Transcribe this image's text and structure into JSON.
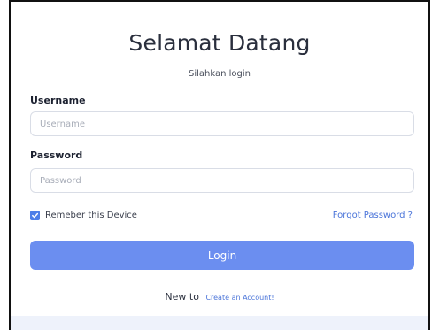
{
  "header": {
    "title": "Selamat Datang",
    "subtitle": "Silahkan login"
  },
  "form": {
    "username_label": "Username",
    "username_placeholder": "Username",
    "username_value": "",
    "password_label": "Password",
    "password_placeholder": "Password",
    "password_value": "",
    "remember_label": "Remeber this Device",
    "remember_checked": true,
    "forgot_link": "Forgot Password ?",
    "login_button": "Login"
  },
  "footer": {
    "new_to": "New to",
    "create_account_link": "Create an Account!"
  },
  "colors": {
    "primary_button": "#6b8ef0",
    "link": "#4a74d9",
    "checkbox": "#4d7ee8"
  }
}
